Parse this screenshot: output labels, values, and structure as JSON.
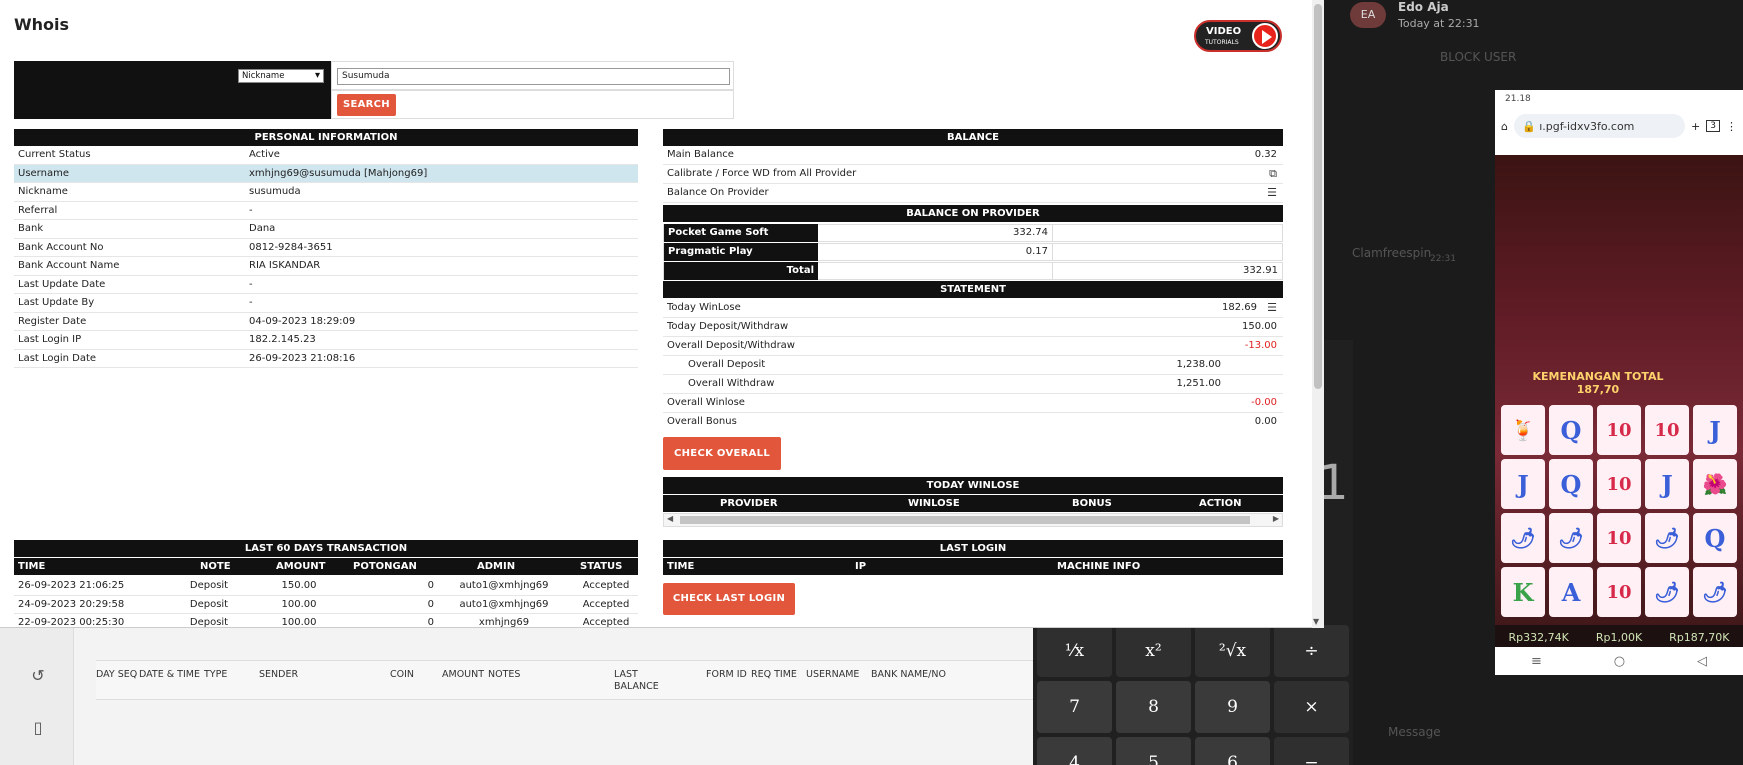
{
  "background": {
    "chat": {
      "avatar_initials": "EA",
      "name": "Edo Aja",
      "time": "Today at 22:31",
      "ghost_text_1": "BLOCK USER",
      "ghost_text_2": "Clamfreespin",
      "ghost_text_3": "22:31",
      "message_placeholder": "Message"
    },
    "calculator": {
      "display_digit": "1",
      "keys": [
        "¹⁄x",
        "x²",
        "²√x",
        "÷",
        "7",
        "8",
        "9",
        "×",
        "4",
        "5",
        "6",
        "−"
      ]
    },
    "phone": {
      "status_time": "21.18",
      "url": "ı.pgf-idxv3fo.com",
      "tab_count": "3",
      "game_title": "KEMENANGAN TOTAL 187,70",
      "grid": [
        [
          "🍹",
          "Q",
          "10",
          "10",
          "J"
        ],
        [
          "J",
          "Q",
          "10",
          "J",
          "🌺"
        ],
        [
          "🌶",
          "🌶",
          "10",
          "🌶",
          "Q"
        ],
        [
          "K",
          "A",
          "10",
          "🌶",
          "🌶"
        ]
      ],
      "bar": [
        "Rp332,74K",
        "Rp1,00K",
        "Rp187,70K"
      ]
    },
    "list_headers": [
      "DAY SEQ",
      "DATE & TIME",
      "TYPE",
      "SENDER",
      "COIN",
      "AMOUNT",
      "NOTES",
      "LAST BALANCE",
      "FORM ID",
      "REQ TIME",
      "USERNAME",
      "BANK NAME/NO"
    ]
  },
  "modal": {
    "title": "Whois",
    "video_badge": {
      "line1": "VIDEO",
      "line2": "TUTORIALS"
    },
    "search": {
      "selected": "Nickname",
      "value": "Susumuda",
      "button": "SEARCH"
    },
    "personal": {
      "header": "PERSONAL INFORMATION",
      "rows": [
        {
          "k": "Current Status",
          "v": "Active"
        },
        {
          "k": "Username",
          "v": "xmhjng69@susumuda  [Mahjong69]"
        },
        {
          "k": "Nickname",
          "v": "susumuda"
        },
        {
          "k": "Referral",
          "v": "-"
        },
        {
          "k": "Bank",
          "v": "Dana"
        },
        {
          "k": "Bank Account No",
          "v": "0812-9284-3651"
        },
        {
          "k": "Bank Account Name",
          "v": "RIA ISKANDAR"
        },
        {
          "k": "Last Update Date",
          "v": "-"
        },
        {
          "k": "Last Update By",
          "v": "-"
        },
        {
          "k": "Register Date",
          "v": "04-09-2023 18:29:09"
        },
        {
          "k": "Last Login IP",
          "v": "182.2.145.23"
        },
        {
          "k": "Last Login Date",
          "v": "26-09-2023 21:08:16"
        }
      ]
    },
    "balance": {
      "header": "BALANCE",
      "main_balance_label": "Main Balance",
      "main_balance": "0.32",
      "calibrate_label": "Calibrate / Force WD from All Provider",
      "balance_on_provider_label": "Balance On Provider"
    },
    "provider": {
      "header": "BALANCE ON PROVIDER",
      "rows": [
        {
          "name": "Pocket Game Soft",
          "value": "332.74"
        },
        {
          "name": "Pragmatic Play",
          "value": "0.17"
        }
      ],
      "total_label": "Total",
      "total": "332.91"
    },
    "statement": {
      "header": "STATEMENT",
      "today_winlose_label": "Today WinLose",
      "today_winlose": "182.69",
      "today_dw_label": "Today Deposit/Withdraw",
      "today_dw": "150.00",
      "overall_dw_label": "Overall Deposit/Withdraw",
      "overall_dw": "-13.00",
      "overall_deposit_label": "Overall Deposit",
      "overall_deposit": "1,238.00",
      "overall_withdraw_label": "Overall Withdraw",
      "overall_withdraw": "1,251.00",
      "overall_winlose_label": "Overall Winlose",
      "overall_winlose": "-0.00",
      "overall_bonus_label": "Overall Bonus",
      "overall_bonus": "0.00",
      "check_overall": "CHECK OVERALL"
    },
    "today_winlose": {
      "header": "TODAY WINLOSE",
      "columns": [
        "PROVIDER",
        "WINLOSE",
        "BONUS",
        "ACTION"
      ]
    },
    "transactions": {
      "header": "LAST 60 DAYS TRANSACTION",
      "columns": [
        "TIME",
        "NOTE",
        "AMOUNT",
        "POTONGAN",
        "ADMIN",
        "STATUS"
      ],
      "rows": [
        [
          "26-09-2023 21:06:25",
          "Deposit",
          "150.00",
          "0",
          "auto1@xmhjng69",
          "Accepted"
        ],
        [
          "24-09-2023 20:29:58",
          "Deposit",
          "100.00",
          "0",
          "auto1@xmhjng69",
          "Accepted"
        ],
        [
          "22-09-2023 00:25:30",
          "Deposit",
          "100.00",
          "0",
          "xmhjng69",
          "Accepted"
        ]
      ]
    },
    "last_login": {
      "header": "LAST LOGIN",
      "columns": [
        "TIME",
        "IP",
        "MACHINE INFO"
      ],
      "button": "CHECK LAST LOGIN"
    }
  }
}
